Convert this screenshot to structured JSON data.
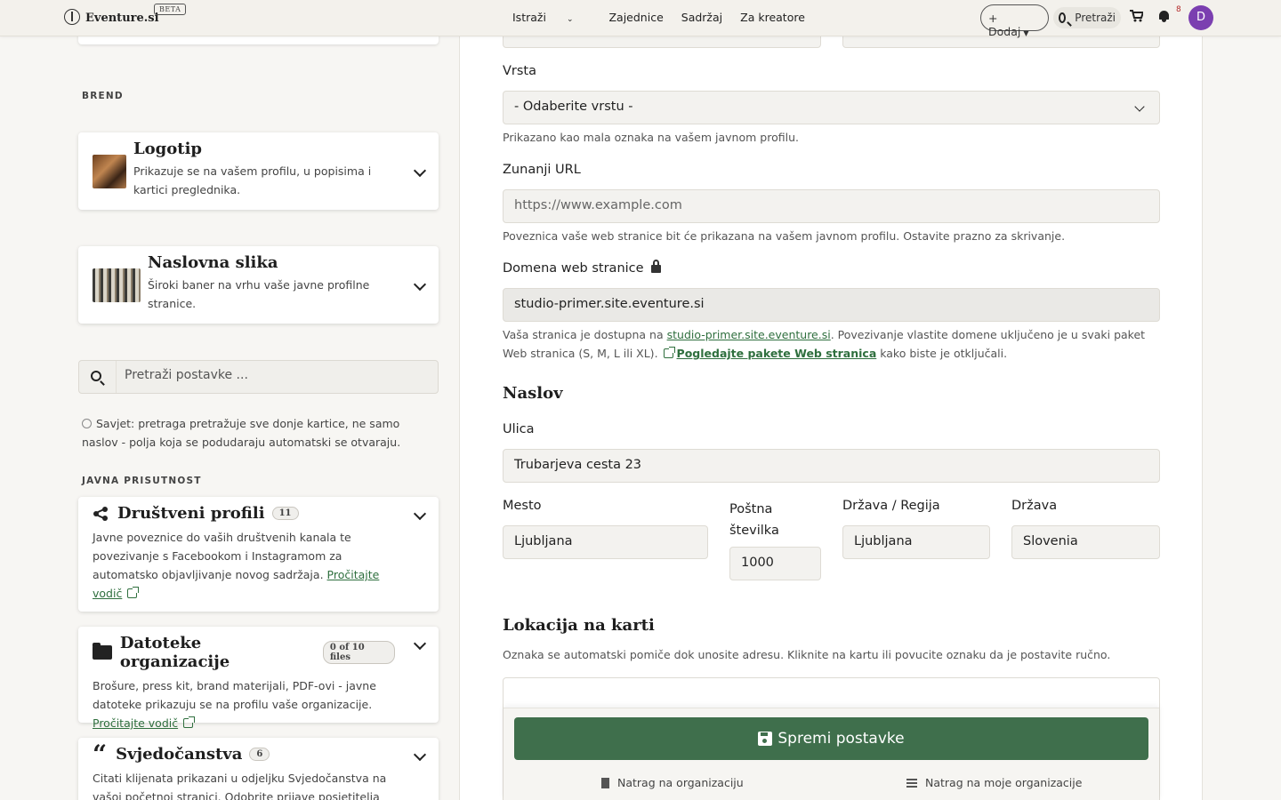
{
  "navbar": {
    "brand": "Eventure.si",
    "beta": "BETA",
    "links": [
      {
        "label": "Istraži",
        "has_caret": true
      },
      {
        "label": "Zajednice"
      },
      {
        "label": "Sadržaj"
      },
      {
        "label": "Za kreatore"
      }
    ],
    "add_label": "+ Dodaj",
    "search_label": "Pretraži",
    "notification_count": "8",
    "avatar_letter": "D"
  },
  "sidebar": {
    "brand_section": "BREND",
    "logo_card": {
      "title": "Logotip",
      "desc": "Prikazuje se na vašem profilu, u popisima i kartici preglednika."
    },
    "cover_card": {
      "title": "Naslovna slika",
      "desc": "Široki baner na vrhu vaše javne profilne stranice."
    },
    "search_placeholder": "Pretraži postavke ...",
    "tip": "Savjet: pretraga pretražuje sve donje kartice, ne samo naslov - polja koja se podudaraju automatski se otvaraju.",
    "public_section": "JAVNA PRISUTNOST",
    "social_card": {
      "title": "Društveni profili",
      "badge": "11",
      "desc": "Javne poveznice do vaših društvenih kanala te povezivanje s Facebookom i Instagramom za automatsko objavljivanje novog sadržaja.",
      "link": "Pročitajte vodič"
    },
    "files_card": {
      "title": "Datoteke organizacije",
      "badge": "0 of 10 files",
      "desc": "Brošure, press kit, brand materijali, PDF-ovi - javne datoteke prikazuju se na profilu vaše organizacije.",
      "link": "Pročitajte vodič"
    },
    "testimonials_card": {
      "title": "Svjedočanstva",
      "badge": "6",
      "desc": "Citati klijenata prikazani u odjeljku Svjedočanstva na vašoj početnoj stranici. Odobrite prijave posjetitelja"
    }
  },
  "form": {
    "type_label": "Vrsta",
    "type_value": "- Odaberite vrstu -",
    "type_help": "Prikazano kao mala oznaka na vašem javnom profilu.",
    "url_label": "Zunanji URL",
    "url_placeholder": "https://www.example.com",
    "url_help": "Poveznica vaše web stranice bit će prikazana na vašem javnom profilu. Ostavite prazno za skrivanje.",
    "domain_label": "Domena web stranice",
    "domain_value": "studio-primer.site.eventure.si",
    "domain_help_pre": "Vaša stranica je dostupna na ",
    "domain_help_link": "studio-primer.site.eventure.si",
    "domain_help_mid": ". Povezivanje vlastite domene uključeno je u svaki paket Web stranica (S, M, L ili XL).",
    "domain_help_link2": "Pogledajte pakete Web stranica",
    "domain_help_post": " kako biste je otključali.",
    "address_heading": "Naslov",
    "street_label": "Ulica",
    "street_value": "Trubarjeva cesta 23",
    "city_label": "Mesto",
    "city_value": "Ljubljana",
    "postal_label": "Poštna številka",
    "postal_value": "1000",
    "region_label": "Država / Regija",
    "region_value": "Ljubljana",
    "country_label": "Država",
    "country_value": "Slovenia",
    "map_heading": "Lokacija na karti",
    "map_help": "Oznaka se automatski pomiče dok unosite adresu. Kliknite na kartu ili povucite oznaku da je postavite ručno."
  },
  "actions": {
    "save_label": "Spremi postavke",
    "back_org": "Natrag na organizaciju",
    "back_my_orgs": "Natrag na moje organizacije"
  },
  "colors": {
    "primary_green": "#3f6f4c",
    "link_green": "#2f6f3e",
    "avatar_purple": "#7b3fb0"
  }
}
